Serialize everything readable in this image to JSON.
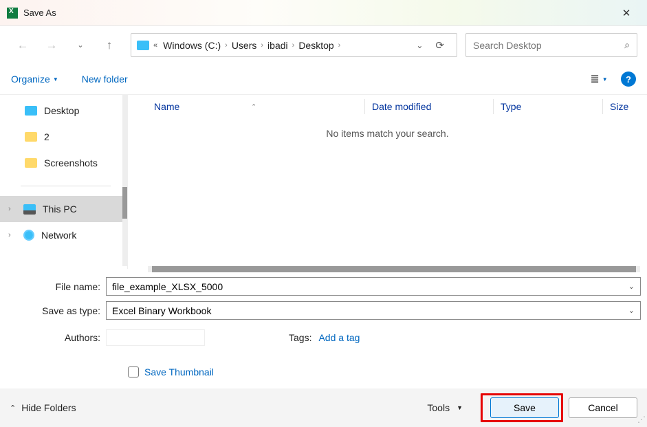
{
  "window": {
    "title": "Save As"
  },
  "breadcrumb": {
    "items": [
      "Windows (C:)",
      "Users",
      "ibadi",
      "Desktop"
    ]
  },
  "search": {
    "placeholder": "Search Desktop"
  },
  "toolbar": {
    "organize": "Organize",
    "newfolder": "New folder"
  },
  "sidebar": {
    "quick": [
      {
        "label": "Desktop",
        "icon": "blue"
      },
      {
        "label": "2",
        "icon": "yellow"
      },
      {
        "label": "Screenshots",
        "icon": "yellow"
      }
    ],
    "tree": [
      {
        "label": "This PC",
        "icon": "pc",
        "selected": true
      },
      {
        "label": "Network",
        "icon": "net",
        "selected": false
      }
    ]
  },
  "columns": {
    "name": "Name",
    "date": "Date modified",
    "type": "Type",
    "size": "Size"
  },
  "content": {
    "empty": "No items match your search."
  },
  "form": {
    "filename_label": "File name:",
    "filename_value": "file_example_XLSX_5000",
    "saveastype_label": "Save as type:",
    "saveastype_value": "Excel Binary Workbook",
    "authors_label": "Authors:",
    "tags_label": "Tags:",
    "tags_link": "Add a tag",
    "thumbnail": "Save Thumbnail"
  },
  "footer": {
    "hidefolders": "Hide Folders",
    "tools": "Tools",
    "save": "Save",
    "cancel": "Cancel"
  }
}
